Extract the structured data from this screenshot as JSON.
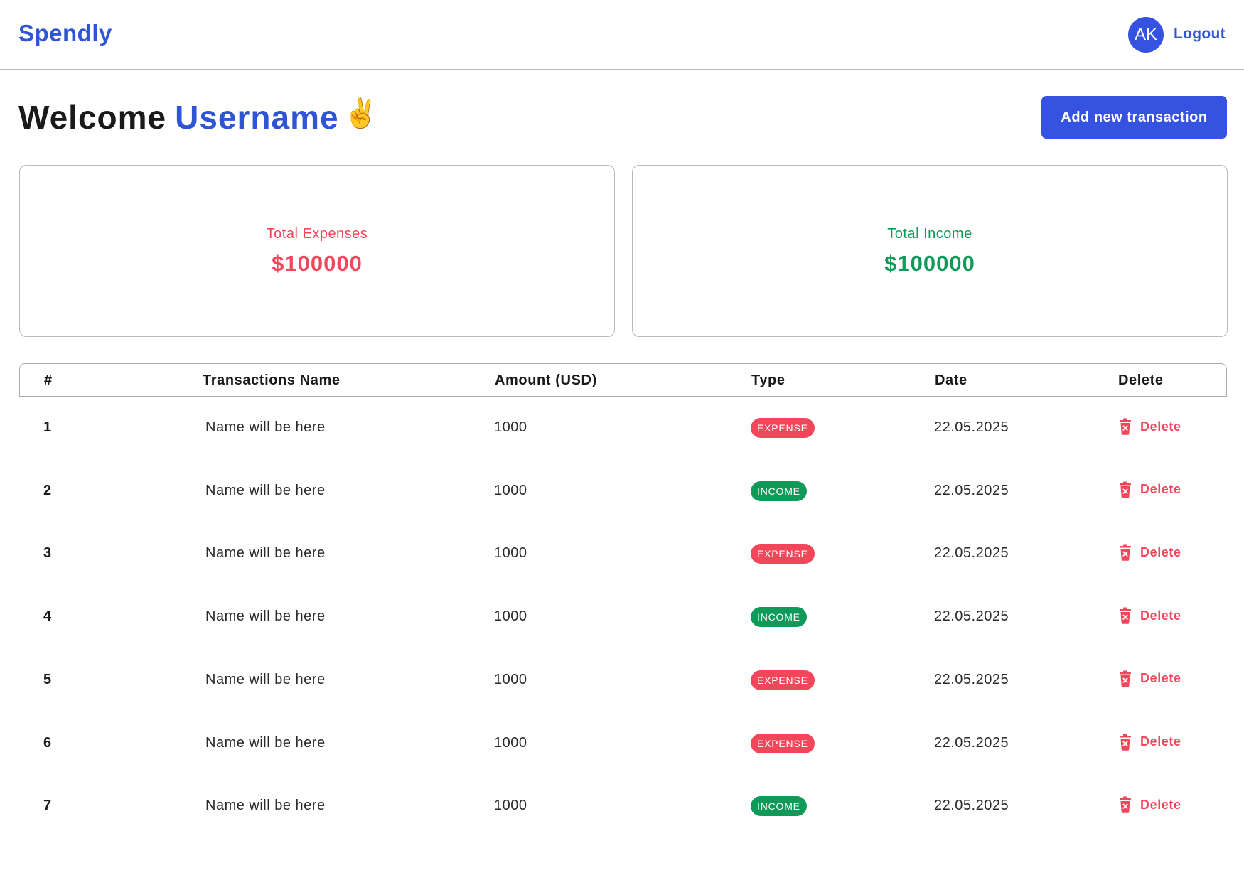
{
  "header": {
    "brand": "Spendly",
    "avatar_initials": "AK",
    "logout_label": "Logout"
  },
  "welcome": {
    "greeting": "Welcome",
    "username": "Username",
    "emoji": "✌️"
  },
  "add_button_label": "Add new transaction",
  "summary": {
    "expenses_label": "Total Expenses",
    "expenses_value": "$100000",
    "income_label": "Total Income",
    "income_value": "$100000"
  },
  "table": {
    "columns": [
      "#",
      "Transactions Name",
      "Amount (USD)",
      "Type",
      "Date",
      "Delete"
    ],
    "rows": [
      {
        "num": "1",
        "name": "Name will be here",
        "amount": "1000",
        "type": "EXPENSE",
        "date": "22.05.2025",
        "action": "Delete"
      },
      {
        "num": "2",
        "name": "Name will be here",
        "amount": "1000",
        "type": "INCOME",
        "date": "22.05.2025",
        "action": "Delete"
      },
      {
        "num": "3",
        "name": "Name will be here",
        "amount": "1000",
        "type": "EXPENSE",
        "date": "22.05.2025",
        "action": "Delete"
      },
      {
        "num": "4",
        "name": "Name will be here",
        "amount": "1000",
        "type": "INCOME",
        "date": "22.05.2025",
        "action": "Delete"
      },
      {
        "num": "5",
        "name": "Name will be here",
        "amount": "1000",
        "type": "EXPENSE",
        "date": "22.05.2025",
        "action": "Delete"
      },
      {
        "num": "6",
        "name": "Name will be here",
        "amount": "1000",
        "type": "EXPENSE",
        "date": "22.05.2025",
        "action": "Delete"
      },
      {
        "num": "7",
        "name": "Name will be here",
        "amount": "1000",
        "type": "INCOME",
        "date": "22.05.2025",
        "action": "Delete"
      }
    ]
  },
  "colors": {
    "brand": "#2f55d4",
    "button": "#3553e0",
    "expense": "#f2475a",
    "income": "#0f9a5a"
  },
  "icons": {
    "delete": "trash-icon"
  }
}
